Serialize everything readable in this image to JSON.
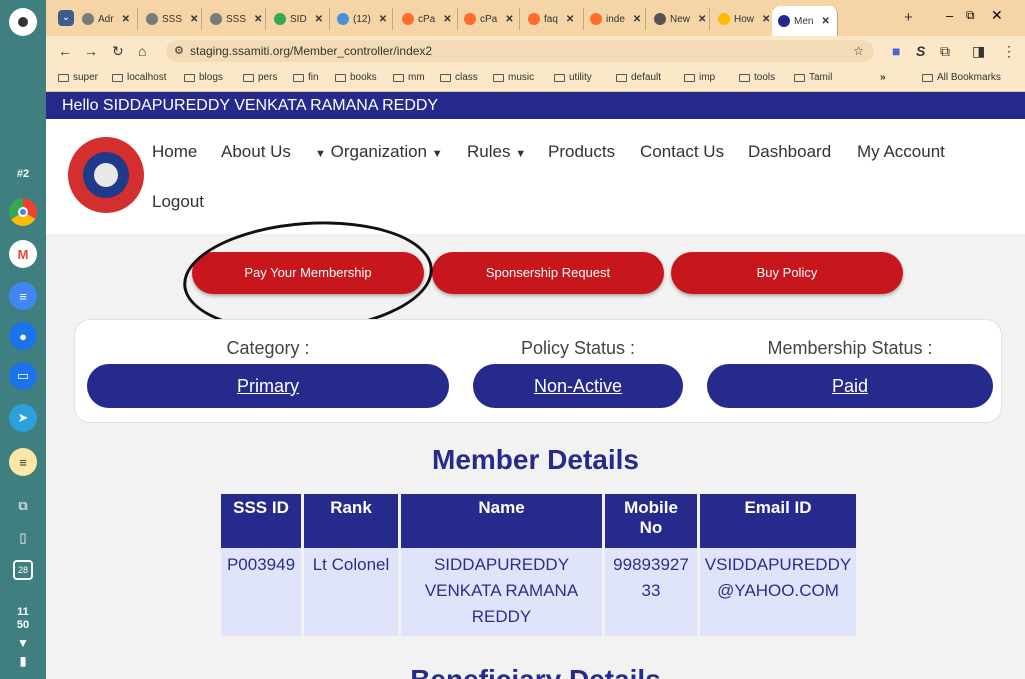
{
  "shelf": {
    "badge_text": "#2",
    "calendar_date": "28",
    "clock_hour": "11",
    "clock_min": "50"
  },
  "browser": {
    "tabs": [
      {
        "label": "Adr",
        "color": "#7a7a7a"
      },
      {
        "label": "SSS",
        "color": "#7a7a7a"
      },
      {
        "label": "SSS",
        "color": "#7a7a7a"
      },
      {
        "label": "SID",
        "color": "#34a853"
      },
      {
        "label": "(12)",
        "color": "#4a90d9"
      },
      {
        "label": "cPa",
        "color": "#ff6c2c"
      },
      {
        "label": "cPa",
        "color": "#ff6c2c"
      },
      {
        "label": "faq",
        "color": "#ff6c2c"
      },
      {
        "label": "inde",
        "color": "#ff6c2c"
      },
      {
        "label": "New",
        "color": "#555555"
      },
      {
        "label": "How",
        "color": "#fbbc04"
      },
      {
        "label": "Men",
        "color": "#262a8c"
      }
    ],
    "url": "staging.ssamiti.org/Member_controller/index2",
    "bookmarks": [
      "super",
      "localhost",
      "blogs",
      "pers",
      "fin",
      "books",
      "mm",
      "class",
      "music",
      "utility",
      "default",
      "imp",
      "tools",
      "Tamil"
    ],
    "all_bookmarks": "All Bookmarks"
  },
  "page": {
    "greeting": "Hello SIDDAPUREDDY VENKATA RAMANA REDDY",
    "nav": {
      "home": "Home",
      "about": "About Us",
      "organization": "Organization",
      "rules": "Rules",
      "products": "Products",
      "contact": "Contact Us",
      "dashboard": "Dashboard",
      "account": "My Account",
      "logout": "Logout"
    },
    "actions": {
      "pay": "Pay Your Membership",
      "sponsor": "Sponsership Request",
      "policy": "Buy Policy"
    },
    "status": {
      "category_label": "Category :",
      "category_value": "Primary",
      "policy_label": "Policy Status :",
      "policy_value": "Non-Active",
      "membership_label": "Membership Status :",
      "membership_value": "Paid"
    },
    "member_title": "Member Details",
    "member_table": {
      "headers": [
        "SSS ID",
        "Rank",
        "Name",
        "Mobile No",
        "Email ID"
      ],
      "row": [
        "P003949",
        "Lt Colonel",
        "SIDDAPUREDDY VENKATA RAMANA REDDY",
        "9989392733",
        "VSIDDAPUREDDY@YAHOO.COM"
      ]
    },
    "beneficiary_title": "Beneficiary Details"
  }
}
